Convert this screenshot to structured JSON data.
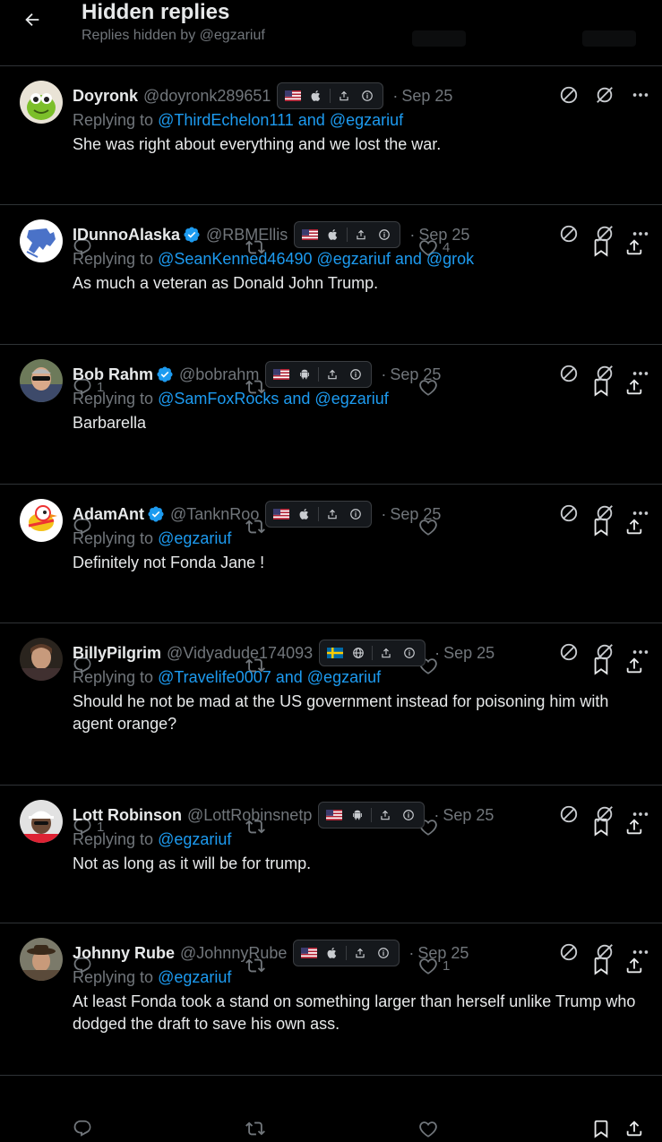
{
  "header": {
    "title": "Hidden replies",
    "subtitle": "Replies hidden by @egzariuf"
  },
  "tweets": [
    {
      "name": "Doyronk",
      "handle": "@doyronk289651",
      "verified": false,
      "flag": "US",
      "device": "apple-icon",
      "date": "Sep 25",
      "replying_prefix": "Replying to ",
      "mentions": [
        "@ThirdEchelon111",
        "@egzariuf"
      ],
      "text": "She was right about everything and we lost the war.",
      "replies": "",
      "reposts": "",
      "likes": "4",
      "avatar": "green-creature"
    },
    {
      "name": "IDunnoAlaska",
      "handle": "@RBMEllis",
      "verified": true,
      "flag": "US",
      "device": "apple-icon",
      "date": "Sep 25",
      "replying_prefix": "Replying to ",
      "mentions": [
        "@SeanKenned46490",
        "@egzariuf",
        "@grok"
      ],
      "text": "As much a veteran as Donald John Trump.",
      "replies": "1",
      "reposts": "",
      "likes": "",
      "avatar": "alaska-map"
    },
    {
      "name": "Bob Rahm",
      "handle": "@bobrahm",
      "verified": true,
      "flag": "US",
      "device": "android-icon",
      "date": "Sep 25",
      "replying_prefix": "Replying to ",
      "mentions": [
        "@SamFoxRocks",
        "@egzariuf"
      ],
      "text": "Barbarella",
      "replies": "",
      "reposts": "",
      "likes": "",
      "avatar": "man-sunglasses"
    },
    {
      "name": "AdamAnt",
      "handle": "@TanknRoo",
      "verified": true,
      "flag": "US",
      "device": "apple-icon",
      "date": "Sep 25",
      "replying_prefix": "Replying to ",
      "mentions": [
        "@egzariuf"
      ],
      "text": "Definitely not Fonda Jane !",
      "replies": "",
      "reposts": "",
      "likes": "",
      "avatar": "cartoon-bird"
    },
    {
      "name": "BillyPilgrim",
      "handle": "@Vidyadude174093",
      "verified": false,
      "flag": "SE",
      "device": "globe-icon",
      "date": "Sep 25",
      "replying_prefix": "Replying to ",
      "mentions": [
        "@Travelife0007",
        "@egzariuf"
      ],
      "text": "Should he not be mad at the US government instead for poisoning him with agent orange?",
      "replies": "1",
      "reposts": "",
      "likes": "",
      "avatar": "man-dark"
    },
    {
      "name": "Lott Robinson",
      "handle": "@LottRobinsnetp",
      "verified": false,
      "flag": "US",
      "device": "android-icon",
      "date": "Sep 25",
      "replying_prefix": "Replying to ",
      "mentions": [
        "@egzariuf"
      ],
      "text": "Not as long as it will be for trump.",
      "replies": "",
      "reposts": "",
      "likes": "1",
      "avatar": "man-cap"
    },
    {
      "name": "Johnny Rube",
      "handle": "@JohnnyRube",
      "verified": false,
      "flag": "US",
      "device": "apple-icon",
      "date": "Sep 25",
      "replying_prefix": "Replying to ",
      "mentions": [
        "@egzariuf"
      ],
      "text": "At least Fonda took a stand on something larger than herself unlike Trump who dodged the draft to save his own ass.",
      "replies": "",
      "reposts": "",
      "likes": "",
      "avatar": "man-hat"
    }
  ],
  "connectors": {
    "and": " and "
  },
  "colors": {
    "accent": "#1d9bf0",
    "muted": "#71767b",
    "text": "#e7e9ea",
    "border": "#2f3336"
  }
}
